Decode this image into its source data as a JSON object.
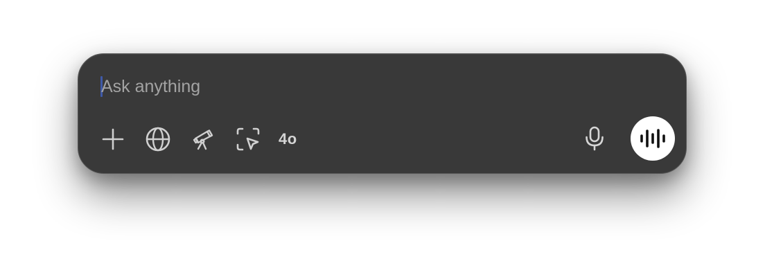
{
  "composer": {
    "placeholder": "Ask anything",
    "value": ""
  },
  "toolbar": {
    "attach_icon": "plus-icon",
    "search_icon": "globe-icon",
    "research_icon": "telescope-icon",
    "screen_icon": "screen-select-cursor-icon",
    "model_label": "4o",
    "dictate_icon": "microphone-icon",
    "voice_icon": "voice-waveform-icon"
  },
  "colors": {
    "panel_bg": "#393939",
    "icon": "#d0d0d0",
    "placeholder": "#a3a3a3",
    "caret": "#3f5aa8",
    "voice_button_bg": "#ffffff",
    "voice_button_fg": "#111111"
  }
}
